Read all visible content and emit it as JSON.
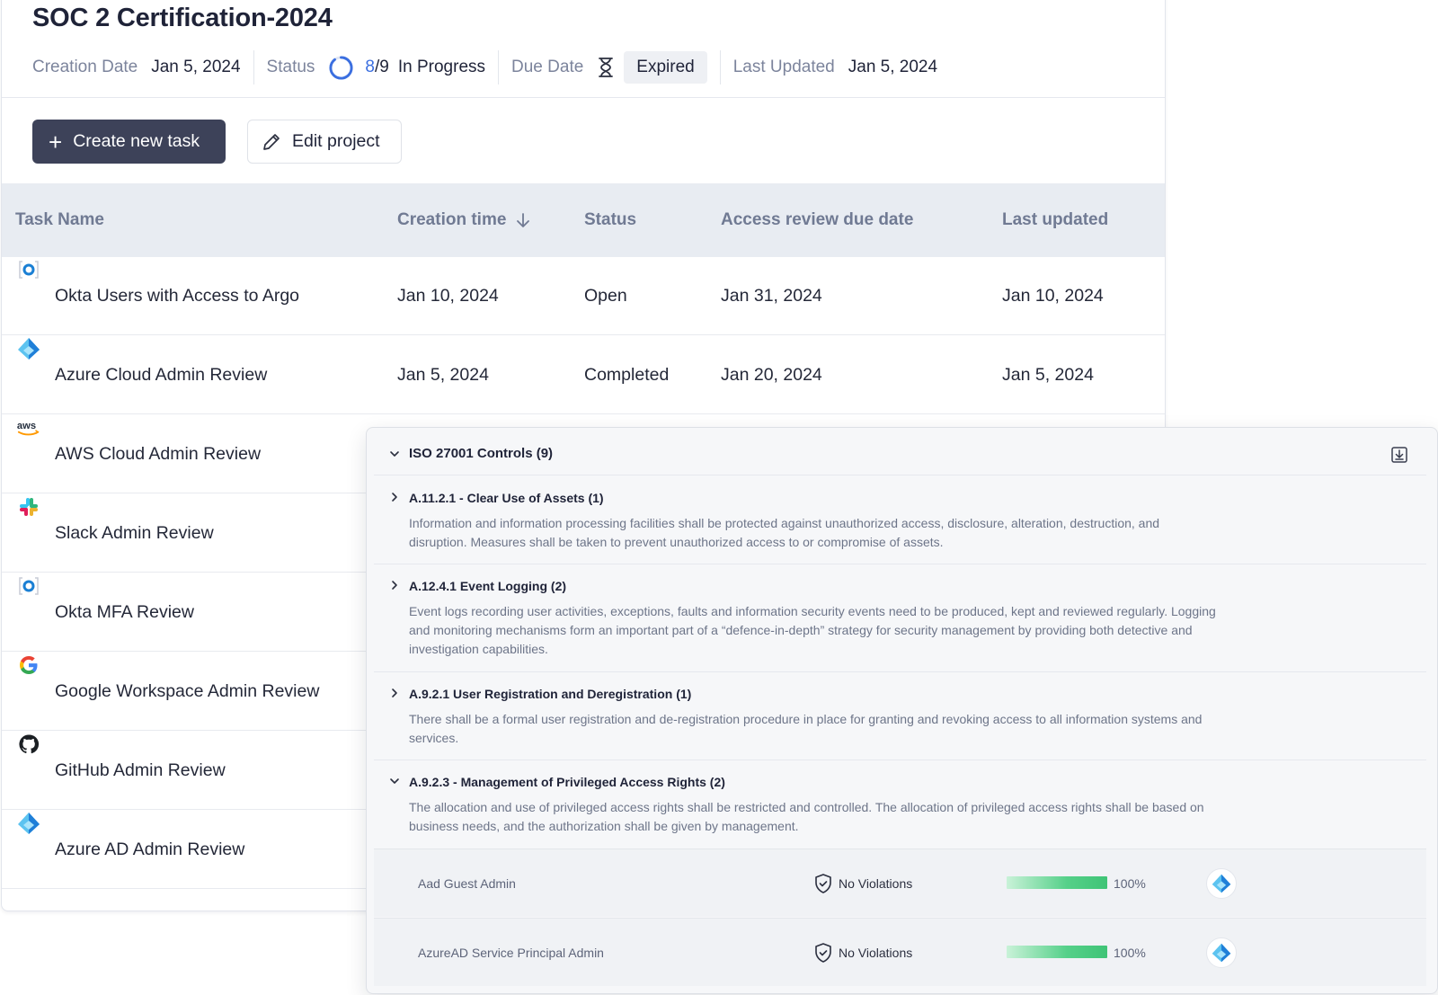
{
  "project": {
    "title": "SOC 2 Certification-2024",
    "meta": {
      "creation_label": "Creation Date",
      "creation_value": "Jan 5, 2024",
      "status_label": "Status",
      "status_done": "8",
      "status_total": "/9",
      "status_text": "In Progress",
      "progress_fraction": 0.89,
      "due_label": "Due Date",
      "due_value": "Expired",
      "updated_label": "Last Updated",
      "updated_value": "Jan 5, 2024"
    },
    "actions": {
      "create_label": "Create new task",
      "edit_label": "Edit project"
    }
  },
  "table": {
    "columns": {
      "name": "Task Name",
      "created": "Creation time",
      "status": "Status",
      "due": "Access review due date",
      "updated": "Last updated"
    },
    "rows": [
      {
        "icon": "okta-icon",
        "name": "Okta Users with Access to Argo",
        "created": "Jan 10, 2024",
        "status": "Open",
        "due": "Jan 31, 2024",
        "updated": "Jan 10, 2024"
      },
      {
        "icon": "azure-icon",
        "name": "Azure Cloud Admin Review",
        "created": "Jan 5, 2024",
        "status": "Completed",
        "due": "Jan 20, 2024",
        "updated": "Jan 5, 2024"
      },
      {
        "icon": "aws-icon",
        "name": "AWS Cloud Admin Review"
      },
      {
        "icon": "slack-icon",
        "name": "Slack Admin Review"
      },
      {
        "icon": "okta-icon",
        "name": "Okta MFA Review"
      },
      {
        "icon": "google-icon",
        "name": "Google Workspace Admin Review"
      },
      {
        "icon": "github-icon",
        "name": "GitHub Admin Review"
      },
      {
        "icon": "azure-icon",
        "name": "Azure AD Admin Review"
      }
    ]
  },
  "controls": {
    "title": "ISO 27001 Controls (9)",
    "items": [
      {
        "title": "A.11.2.1 - Clear Use of Assets (1)",
        "desc": "Information and information processing facilities shall be protected against unauthorized access, disclosure, alteration, destruction, and disruption. Measures shall be taken to prevent unauthorized access to or compromise of assets."
      },
      {
        "title": "A.12.4.1 Event Logging (2)",
        "desc": "Event logs recording user activities, exceptions, faults and information security events need to be produced, kept and reviewed regularly. Logging and monitoring mechanisms form an important part of a “defence-in-depth” strategy for security management by providing both detective and investigation capabilities."
      },
      {
        "title": "A.9.2.1 User Registration and Deregistration (1)",
        "desc": "There shall be a formal user registration and de-registration procedure in place for granting and revoking access to all information systems and services."
      },
      {
        "title": "A.9.2.3 - Management of Privileged Access Rights (2)",
        "desc": "The allocation and use of privileged access rights shall be restricted and controlled. The allocation of privileged access rights shall be based on business needs, and the authorization shall be given by management."
      }
    ],
    "sub_rows": [
      {
        "name": "Aad Guest Admin",
        "violations": "No Violations",
        "percent": "100%",
        "fraction": 1.0
      },
      {
        "name": "AzureAD Service Principal Admin",
        "violations": "No Violations",
        "percent": "100%",
        "fraction": 1.0
      }
    ]
  },
  "colors": {
    "primary_button": "#3d4259",
    "accent_blue": "#3b6fe0",
    "success_green": "#3fc476"
  }
}
